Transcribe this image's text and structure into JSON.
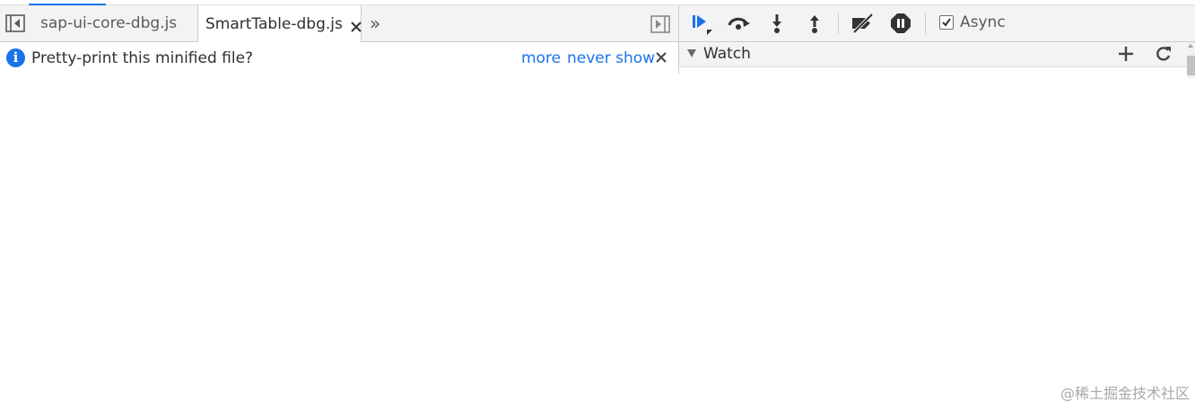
{
  "colors": {
    "accent": "#1a73e8",
    "link": "#1a73e8",
    "toolbar_bg": "#f3f3f3"
  },
  "navigator": {
    "toggle_icon": "show-navigator-icon"
  },
  "tabs": [
    {
      "label": "sap-ui-core-dbg.js",
      "active": false
    },
    {
      "label": "SmartTable-dbg.js",
      "active": true,
      "close_glyph": "×"
    }
  ],
  "more_tabs_glyph": "»",
  "panel_toggle_icon": "toggle-debugger-panel-icon",
  "infobar": {
    "icon_glyph": "i",
    "message": "Pretty-print this minified file?",
    "more_link": "more",
    "never_link": "never show"
  },
  "debugger_toolbar": {
    "buttons": [
      "resume-icon",
      "step-over-icon",
      "step-into-icon",
      "step-out-icon",
      "deactivate-breakpoints-icon",
      "pause-on-exceptions-icon"
    ],
    "async_label": "Async",
    "async_checked": true
  },
  "watch": {
    "title": "Watch"
  },
  "watermark": "@稀土掘金技术社区"
}
